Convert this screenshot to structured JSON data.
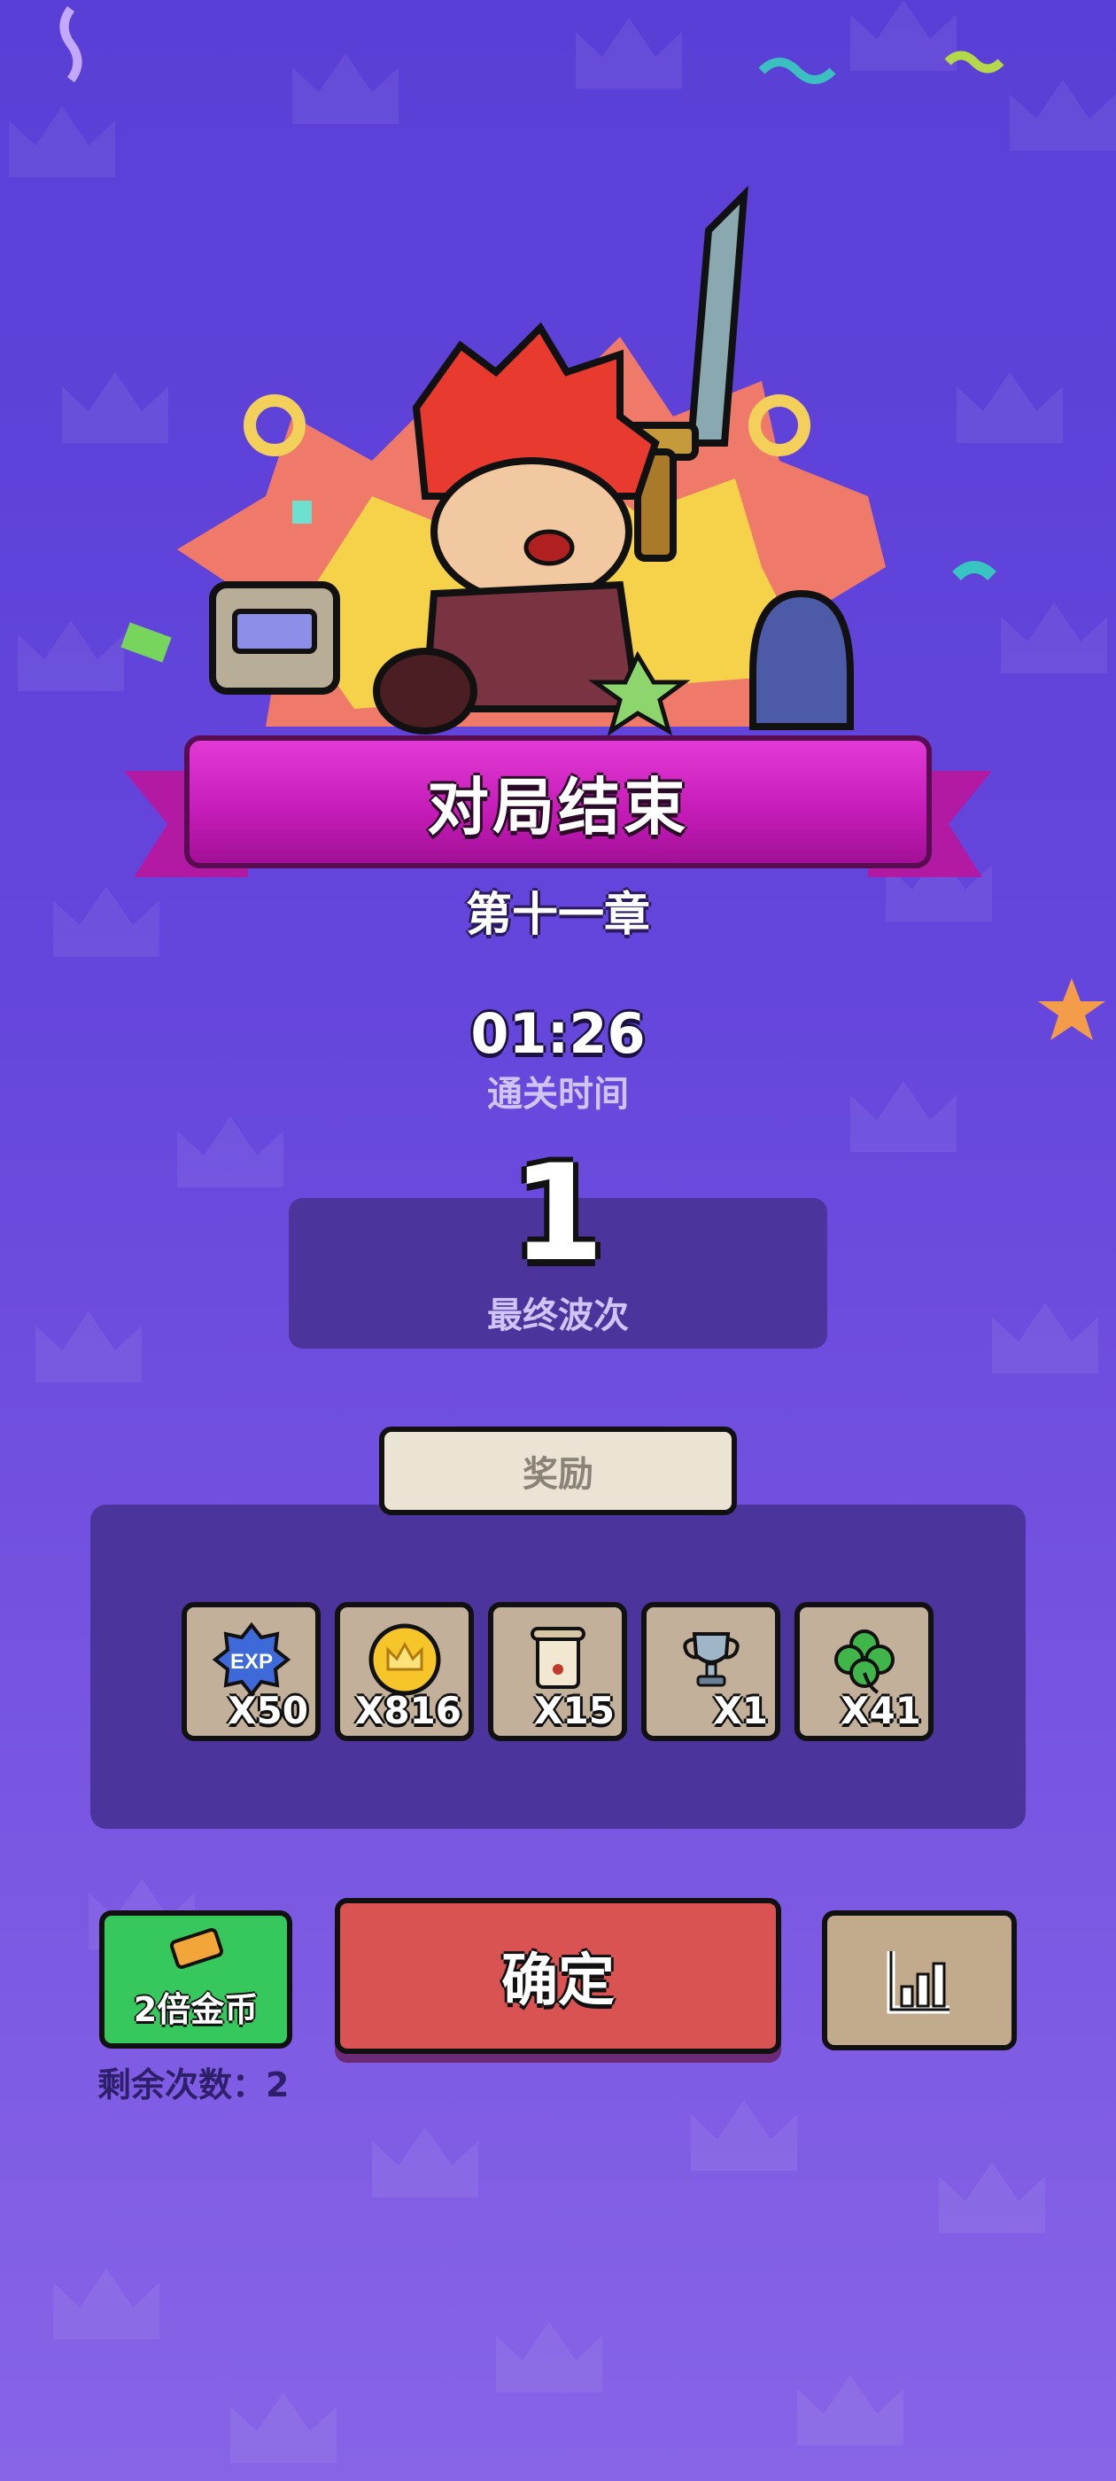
{
  "header": {
    "title": "对局结束",
    "chapter": "第十一章"
  },
  "stats": {
    "clear_time": "01:26",
    "clear_time_label": "通关时间",
    "final_wave": "1",
    "final_wave_label": "最终波次"
  },
  "rewards": {
    "tab_label": "奖励",
    "items": [
      {
        "icon": "exp-icon",
        "label": "EXP",
        "qty": "X50"
      },
      {
        "icon": "gold-coin-icon",
        "qty": "X816"
      },
      {
        "icon": "scroll-icon",
        "qty": "X15"
      },
      {
        "icon": "trophy-icon",
        "qty": "X1"
      },
      {
        "icon": "clover-icon",
        "qty": "X41"
      }
    ]
  },
  "actions": {
    "double_gold_label": "2倍金币",
    "remaining_label": "剩余次数：2",
    "confirm_label": "确定",
    "stats_icon": "bar-chart-icon"
  },
  "colors": {
    "background": "#6546dc",
    "ribbon": "#c41bb7",
    "confirm": "#d95353",
    "double_gold": "#36c85d",
    "panel": "#4b359d"
  }
}
